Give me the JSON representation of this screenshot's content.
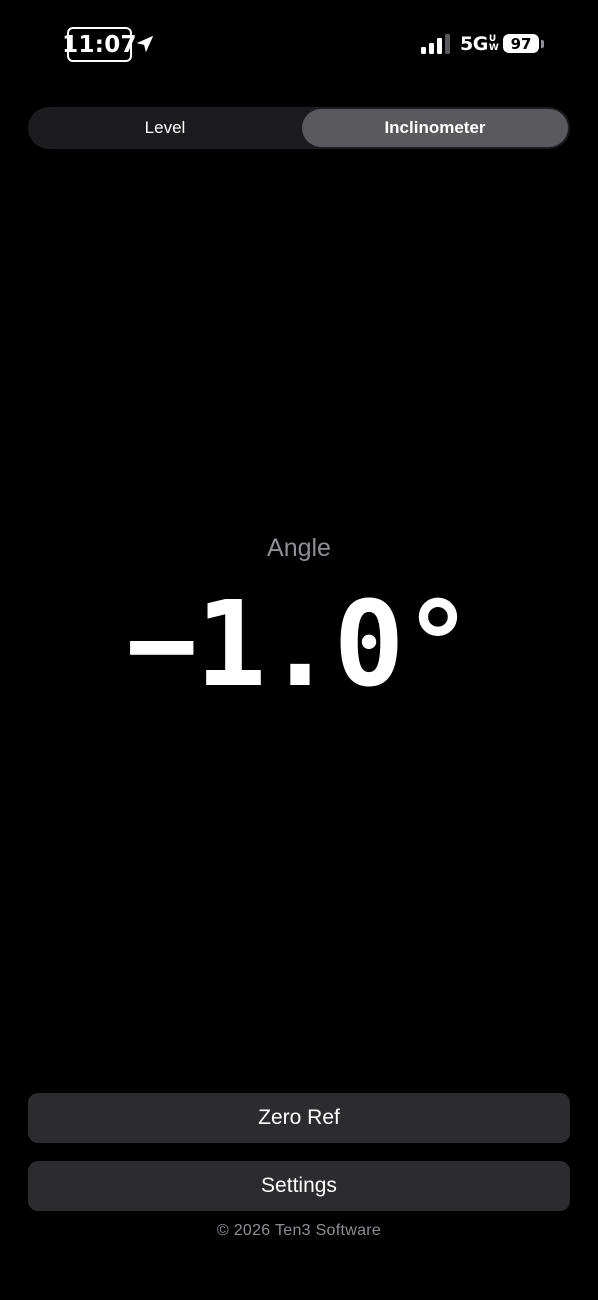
{
  "status_bar": {
    "time": "11:07",
    "network": "5G",
    "network_suffix_top": "U",
    "network_suffix_bottom": "W",
    "battery": "97",
    "icons": [
      "location-arrow-icon",
      "cellular-signal-icon",
      "battery-icon"
    ]
  },
  "tabs": [
    {
      "label": "Level",
      "selected": false
    },
    {
      "label": "Inclinometer",
      "selected": true
    }
  ],
  "readout": {
    "label": "Angle",
    "value": "−1.0°"
  },
  "buttons": {
    "zero_ref": "Zero Ref",
    "settings": "Settings"
  },
  "footer": "© 2026 Ten3 Software",
  "colors": {
    "background": "#000000",
    "segment_track": "#1c1c1e",
    "segment_selected": "#5a5a5e",
    "button": "#2c2c2e",
    "secondary_text": "#8e8e93"
  }
}
